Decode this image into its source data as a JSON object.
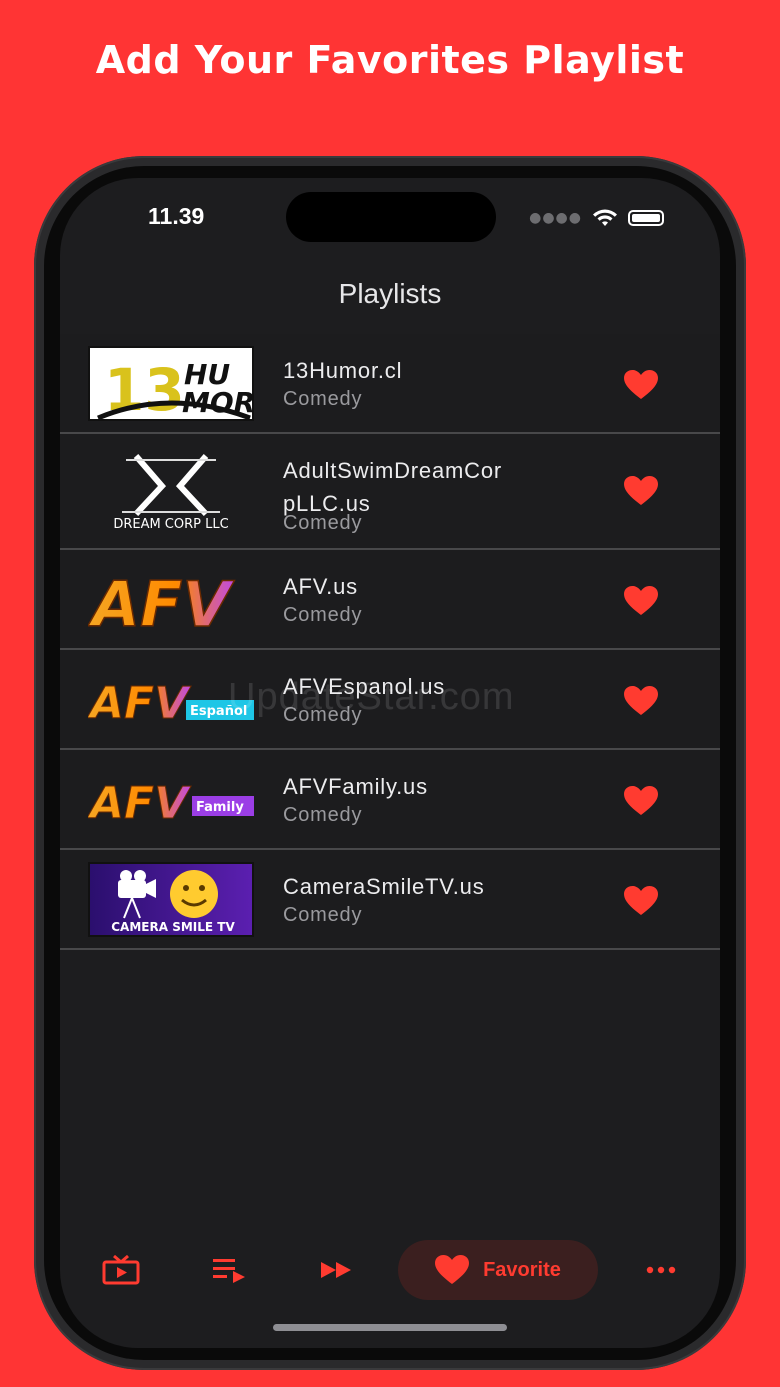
{
  "headline": "Add Your Favorites Playlist",
  "status": {
    "time": "11.39"
  },
  "nav": {
    "title": "Playlists"
  },
  "watermark": "UpdateStar.com",
  "playlists": [
    {
      "title": "13Humor.cl",
      "category": "Comedy",
      "logo_text": [
        "13",
        "HU",
        "MOR"
      ]
    },
    {
      "title": "AdultSwimDreamCor pLLC.us",
      "category": "Comedy",
      "logo_text": [
        "DREAM CORP LLC"
      ]
    },
    {
      "title": "AFV.us",
      "category": "Comedy",
      "logo_text": [
        "AFV"
      ]
    },
    {
      "title": "AFVEspanol.us",
      "category": "Comedy",
      "logo_text": [
        "AFV",
        "Español"
      ]
    },
    {
      "title": "AFVFamily.us",
      "category": "Comedy",
      "logo_text": [
        "AFV",
        "Family"
      ]
    },
    {
      "title": "CameraSmileTV.us",
      "category": "Comedy",
      "logo_text": [
        "CAMERA SMILE TV"
      ]
    }
  ],
  "tabbar": {
    "items": [
      {
        "icon": "tv-icon",
        "label": ""
      },
      {
        "icon": "playlist-icon",
        "label": ""
      },
      {
        "icon": "fast-forward-icon",
        "label": ""
      },
      {
        "icon": "heart-icon",
        "label": "Favorite"
      },
      {
        "icon": "more-icon",
        "label": ""
      }
    ]
  },
  "colors": {
    "accent": "#ff3b30",
    "background": "#ff3434",
    "screen": "#1d1d1f"
  }
}
